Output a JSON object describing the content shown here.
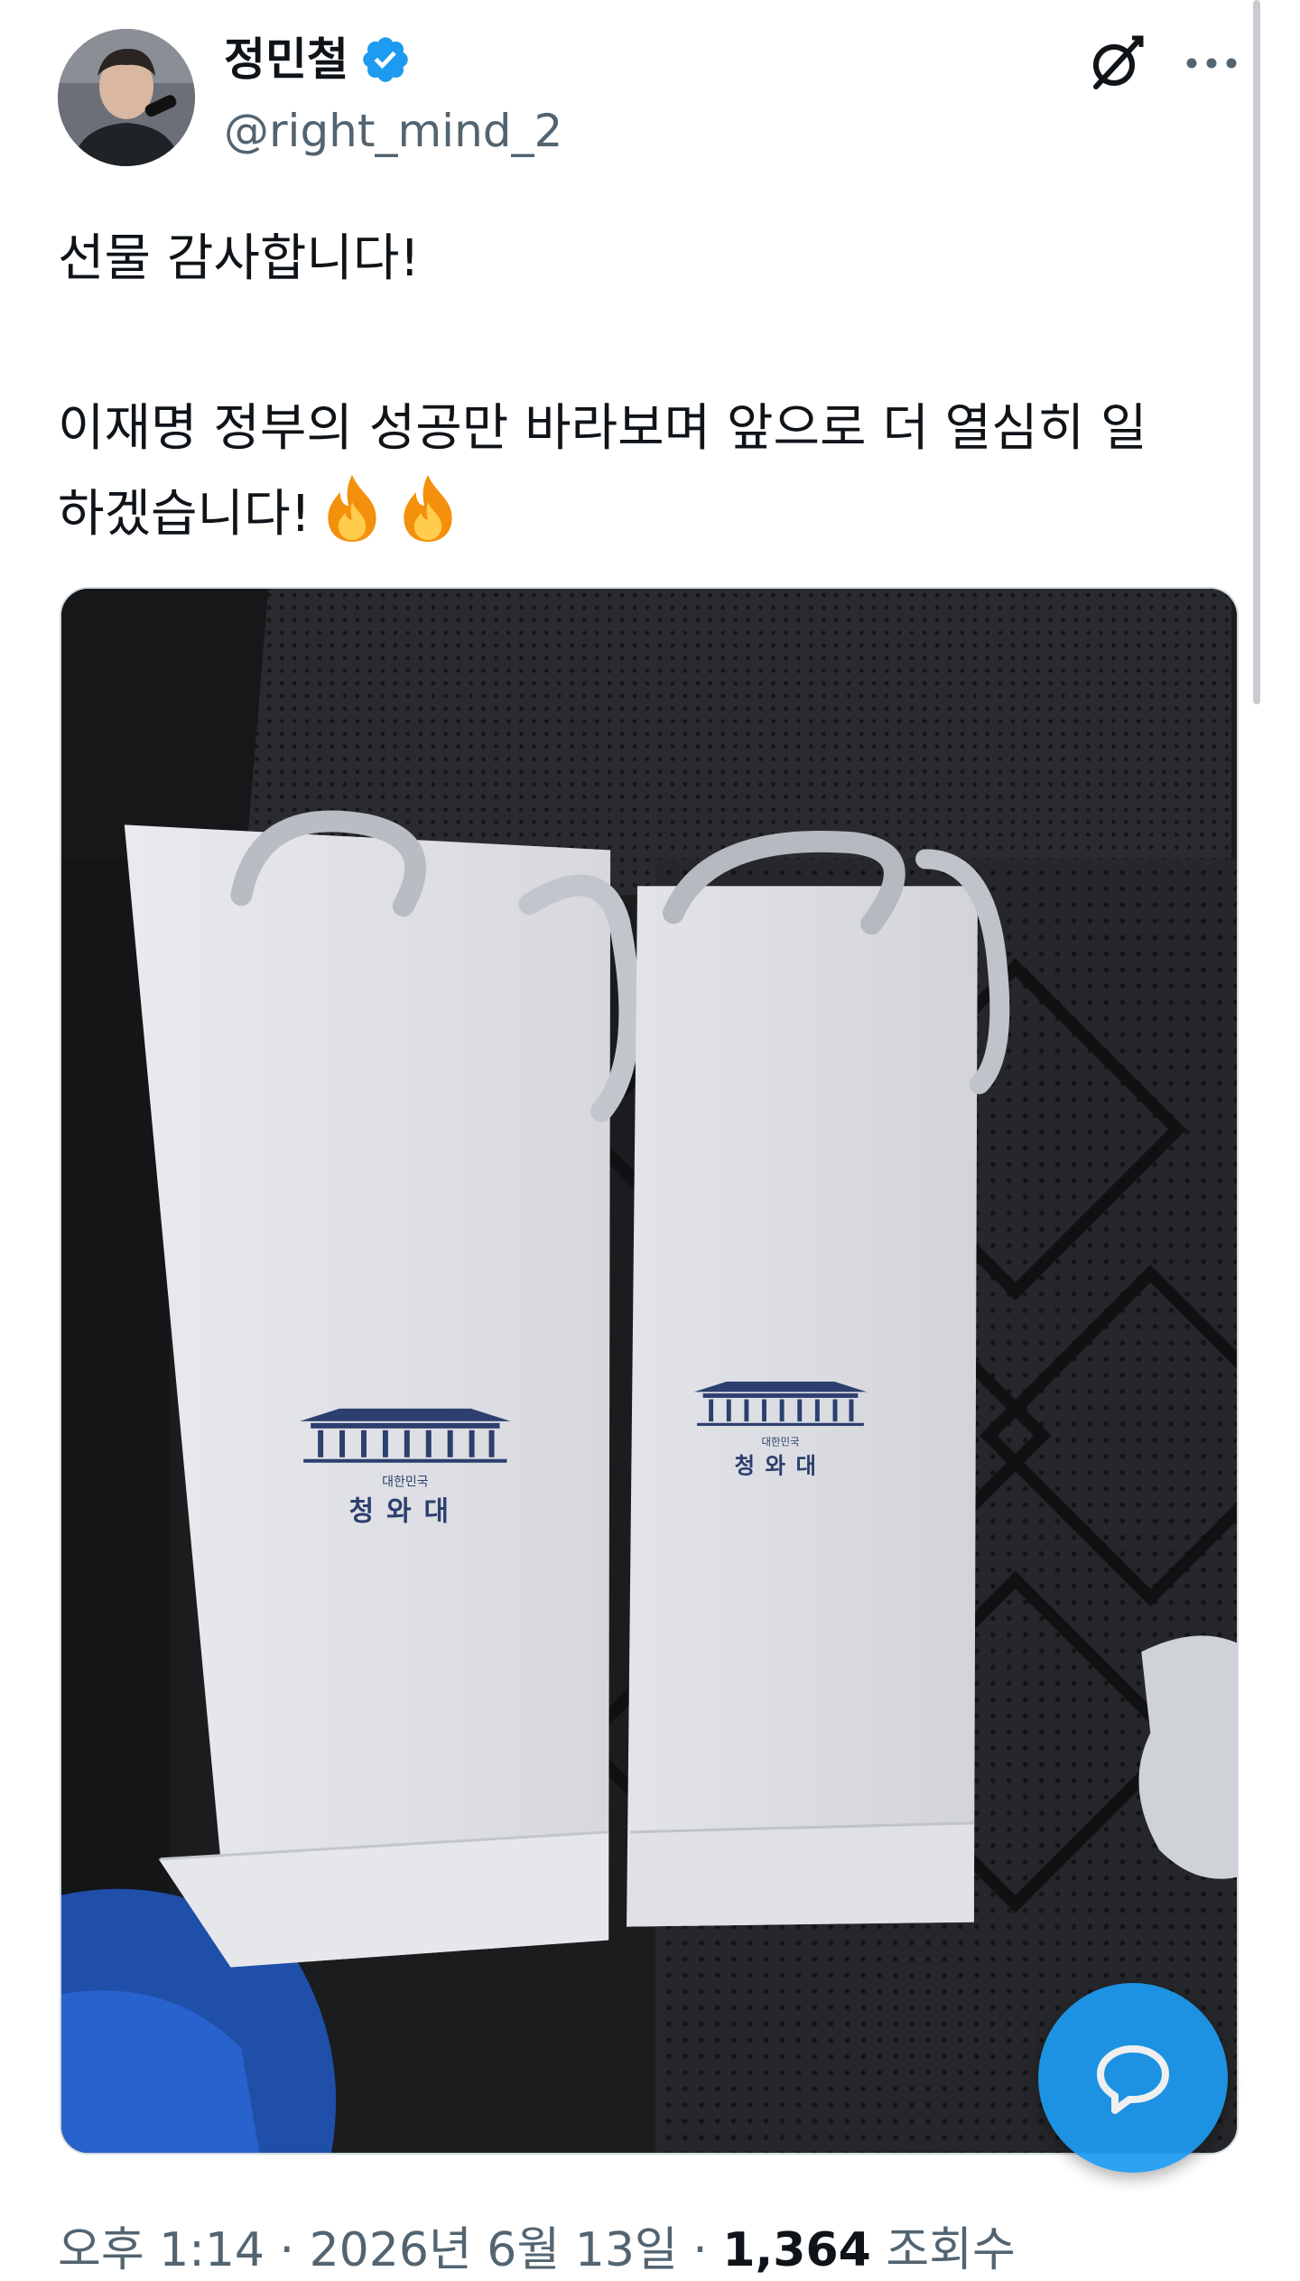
{
  "author": {
    "display_name": "정민철",
    "handle": "@right_mind_2",
    "verified": true,
    "avatar_icon": "profile-photo-icon",
    "verified_icon": "verified-badge-icon"
  },
  "header_actions": {
    "grok_icon": "grok-icon",
    "more_icon": "more-options-icon"
  },
  "tweet": {
    "lines": [
      "선물 감사합니다!",
      "이재명 정부의 성공만 바라보며 앞으로 더 열심히 일",
      "하겠습니다!"
    ],
    "emojis": [
      "fire-emoji-icon",
      "fire-emoji-icon"
    ]
  },
  "media": {
    "bag_text_small": "대한민국",
    "bag_text_large": "청와대"
  },
  "meta": {
    "time": "오후 1:14",
    "separator": "·",
    "date": "2026년 6월 13일",
    "views_count": "1,364",
    "views_label": "조회수"
  },
  "fab": {
    "icon": "reply-bubble-icon"
  },
  "colors": {
    "accent": "#1d9bf0",
    "text": "#0f1419",
    "secondary_text": "#536471"
  }
}
